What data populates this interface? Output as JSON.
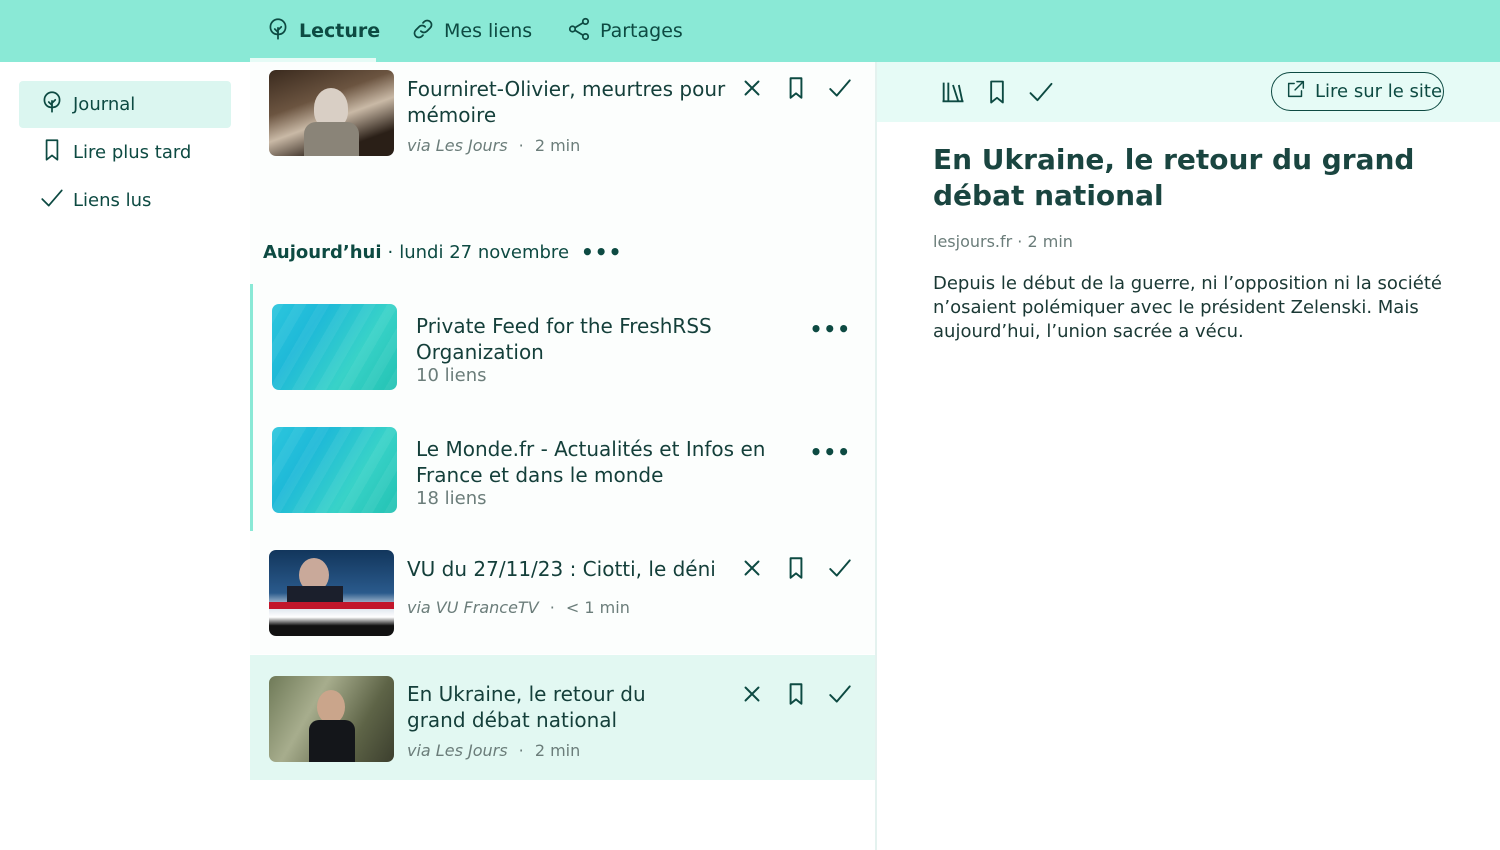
{
  "header": {
    "tabs": [
      {
        "label": "Lecture",
        "icon": "tree-icon",
        "active": true
      },
      {
        "label": "Mes liens",
        "icon": "link-icon",
        "active": false
      },
      {
        "label": "Partages",
        "icon": "share-icon",
        "active": false
      }
    ]
  },
  "sidebar": {
    "items": [
      {
        "label": "Journal",
        "icon": "tree-icon",
        "active": true
      },
      {
        "label": "Lire plus tard",
        "icon": "bookmark-icon",
        "active": false
      },
      {
        "label": "Liens lus",
        "icon": "check-icon",
        "active": false
      }
    ]
  },
  "list": {
    "top_card": {
      "title": "Fourniret-Olivier, meurtres pour mémoire",
      "via": "via Les Jours",
      "separator": "·",
      "duration": "2 min"
    },
    "day_header": {
      "day": "Aujourd’hui",
      "separator": "·",
      "date": "lundi 27 novembre",
      "more": "•••"
    },
    "collections": [
      {
        "title": "Private Feed for the FreshRSS Organization",
        "count": "10 liens",
        "more": "•••"
      },
      {
        "title": "Le Monde.fr - Actualités et Infos en France et dans le monde",
        "count": "18 liens",
        "more": "•••"
      }
    ],
    "cards": [
      {
        "title": "VU du 27/11/23 : Ciotti, le déni",
        "via": "via VU FranceTV",
        "separator": "·",
        "duration": "< 1 min",
        "selected": false
      },
      {
        "title": "En Ukraine, le retour du grand débat national",
        "via": "via Les Jours",
        "separator": "·",
        "duration": "2 min",
        "selected": true
      }
    ]
  },
  "reader": {
    "site_button": "Lire sur le site",
    "title": "En Ukraine, le retour du grand débat national",
    "meta": "lesjours.fr · 2 min",
    "summary": "Depuis le début de la guerre, ni l’opposition ni la société n’osaient polémiquer avec le président Zelenski. Mais aujourd’hui, l’union sacrée a vécu."
  },
  "colors": {
    "header_bg": "#8ae9d6",
    "accent_dark": "#0d4a42",
    "selected_bg": "#e2f8f2",
    "muted_text": "#6b7d7a"
  }
}
